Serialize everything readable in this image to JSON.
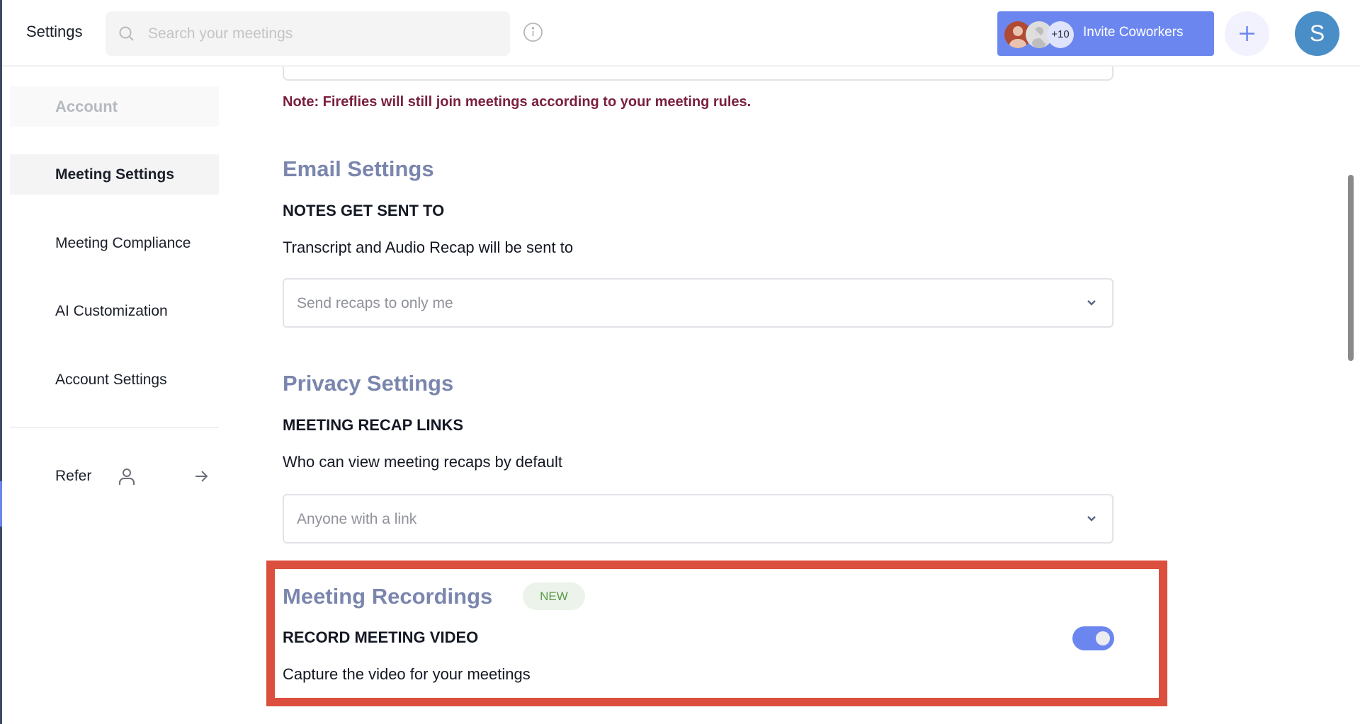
{
  "header": {
    "title": "Settings",
    "search": {
      "placeholder": "Search your meetings",
      "value": ""
    },
    "info_icon": "info-icon",
    "invite": {
      "label": "Invite Coworkers",
      "extra_count": "+10"
    },
    "add_icon": "plus-icon",
    "user_initial": "S"
  },
  "sidebar": {
    "section": "Account",
    "items": [
      {
        "label": "Meeting Settings",
        "active": true
      },
      {
        "label": "Meeting Compliance"
      },
      {
        "label": "AI Customization"
      },
      {
        "label": "Account Settings"
      }
    ],
    "refer": {
      "label": "Refer"
    }
  },
  "main": {
    "note": "Note: Fireflies will still join meetings according to your meeting rules.",
    "email": {
      "heading": "Email Settings",
      "label": "NOTES GET SENT TO",
      "description": "Transcript and Audio Recap will be sent to",
      "dropdown_value": "Send recaps to only me"
    },
    "privacy": {
      "heading": "Privacy Settings",
      "label": "MEETING RECAP LINKS",
      "description": "Who can view meeting recaps by default",
      "dropdown_value": "Anyone with a link"
    },
    "recordings": {
      "heading": "Meeting Recordings",
      "badge": "NEW",
      "label": "RECORD MEETING VIDEO",
      "description": "Capture the video for your meetings",
      "toggle_on": true
    }
  },
  "colors": {
    "accent": "#6b87ef",
    "section_heading": "#7a86ad",
    "note": "#7a1f3d",
    "highlight_box": "#dc4e3d",
    "badge_text": "#5a9a48",
    "badge_bg": "#ecf3ea"
  }
}
